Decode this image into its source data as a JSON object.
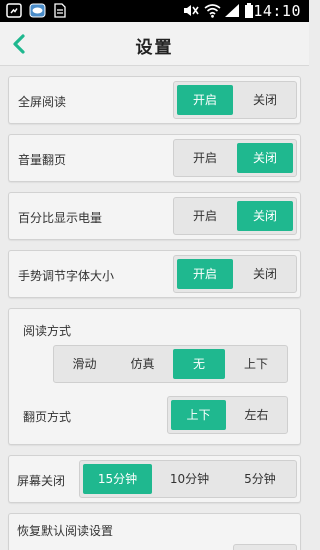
{
  "status_bar": {
    "time": "14:10",
    "left_icons": [
      "notification-icon",
      "gallery-icon",
      "document-icon"
    ],
    "right_icons": [
      "mute-icon",
      "wifi-icon",
      "signal-icon",
      "battery-icon"
    ]
  },
  "header": {
    "title": "设置",
    "back_icon": "chevron-left-icon"
  },
  "accent_color": "#1fb88f",
  "settings": {
    "fullscreen": {
      "label": "全屏阅读",
      "options": [
        "开启",
        "关闭"
      ],
      "selected": 0
    },
    "volume_page": {
      "label": "音量翻页",
      "options": [
        "开启",
        "关闭"
      ],
      "selected": 1
    },
    "battery_percent": {
      "label": "百分比显示电量",
      "options": [
        "开启",
        "关闭"
      ],
      "selected": 1
    },
    "gesture_font": {
      "label": "手势调节字体大小",
      "options": [
        "开启",
        "关闭"
      ],
      "selected": 0
    },
    "read_mode": {
      "label": "阅读方式",
      "options": [
        "滑动",
        "仿真",
        "无",
        "上下"
      ],
      "selected": 2
    },
    "page_mode": {
      "label": "翻页方式",
      "options": [
        "上下",
        "左右"
      ],
      "selected": 0
    },
    "screen_off": {
      "label": "屏幕关闭",
      "options": [
        "15分钟",
        "10分钟",
        "5分钟"
      ],
      "selected": 0
    },
    "reset": {
      "label": "恢复默认阅读设置"
    }
  }
}
